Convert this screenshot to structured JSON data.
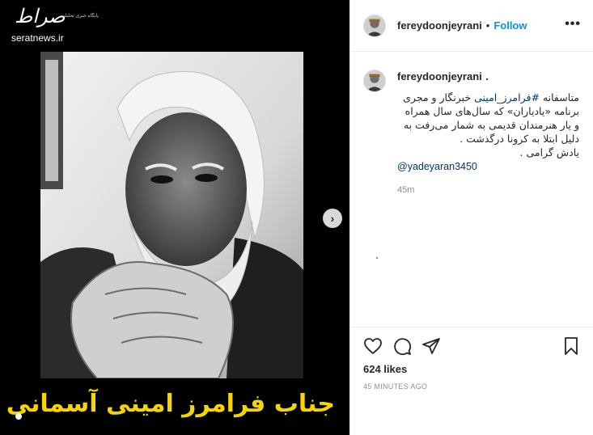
{
  "watermark": {
    "script": "صراط",
    "subtitle": "پایگاه خبری تحلیلی",
    "site": "seratnews.ir"
  },
  "media": {
    "caption": "جناب فرامرز امینی آسمانی شد",
    "next_icon": "chevron-right-icon",
    "next_glyph": "›"
  },
  "header": {
    "username": "fereydoonjeyrani",
    "separator": "•",
    "follow_label": "Follow",
    "more_glyph": "•••"
  },
  "post": {
    "username": "fereydoonjeyrani",
    "username_suffix": ".",
    "text_prefix": "متاسفانه ",
    "hashtag": "#فرامرز_امینی",
    "text_rest": " خبرنگار و مجری برنامه «یادیاران» که سال‌های سال همراه و یار هنرمندان قدیمی به شمار می‌رفت به دلیل ابتلا به کرونا درگذشت .\nیادش گرامی .",
    "mention": "@yadeyaran3450",
    "time": "45m"
  },
  "actions": {
    "icons": [
      "heart-icon",
      "comment-icon",
      "share-icon",
      "bookmark-icon"
    ],
    "likes": "624 likes",
    "posted": "45 MINUTES AGO"
  },
  "colors": {
    "accent": "#0095f6",
    "link": "#00376b",
    "caption": "#f5d400",
    "muted": "#8e8e8e"
  }
}
